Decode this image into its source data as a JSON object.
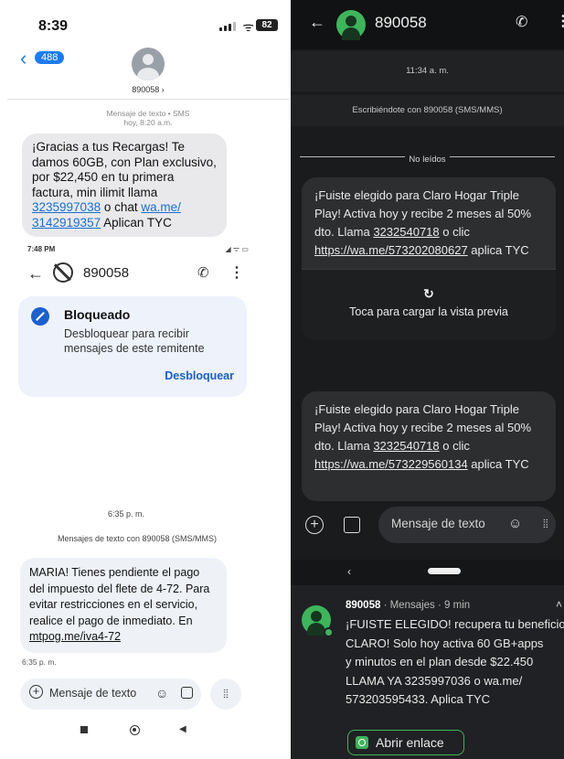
{
  "ios": {
    "status_time": "8:39",
    "battery": "82",
    "back_badge": "488",
    "contact": "890058 ›",
    "meta_line1": "Mensaje de texto • SMS",
    "meta_line2": "hoy, 8:20 a.m.",
    "message": {
      "text1": "¡Gracias a tus Recargas! Te damos 60GB, con Plan exclusivo, por $22,450 en tu primera factura, min ilimit llama ",
      "link1": "3235997038",
      "text2": " o chat ",
      "link2": "wa.me/ 3142919357",
      "text3": " Aplican TYC"
    }
  },
  "android_light": {
    "status_time": "7:48 PM",
    "status_icons": "◢ ᯤ ▭",
    "number": "890058",
    "blocked": {
      "title": "Bloqueado",
      "desc": "Desbloquear para recibir mensajes de este remitente",
      "action": "Desbloquear"
    },
    "time_header": "6:35 p. m.",
    "conversation_header": "Mensajes de texto con 890058 (SMS/MMS)",
    "message": {
      "text": "MARIA! Tienes pendiente el pago del impuesto del flete de 4-72. Para evitar restricciones en el servicio, realice el pago de inmediato. En ",
      "link": "mtpog.me/iva4-72"
    },
    "message_time": "6:35 p. m.",
    "compose_placeholder": "Mensaje de texto"
  },
  "android_dark": {
    "number": "890058",
    "time_header": "11:34 a. m.",
    "conversation_header": "Escribiéndote con 890058 (SMS/MMS)",
    "unread_label": "No leídos",
    "message1": {
      "text1": "¡Fuiste elegido para Claro Hogar Triple Play! Activa hoy y recibe 2 meses al 50% dto. Llama ",
      "phone": "3232540718",
      "text2": " o clic ",
      "link": "https://wa.me/573202080627",
      "text3": " aplica TYC"
    },
    "preview_label": "Toca para cargar la vista previa",
    "message2": {
      "text1": "¡Fuiste elegido para Claro Hogar Triple Play! Activa hoy y recibe 2 meses al 50% dto. Llama ",
      "phone": "3232540718",
      "text2": " o clic ",
      "link": "https://wa.me/573229560134",
      "text3": " aplica TYC"
    },
    "compose_placeholder": "Mensaje de texto"
  },
  "notification": {
    "sender": "890058",
    "subtitle": " · Mensajes · 9 min",
    "lines": [
      "¡FUISTE ELEGIDO! recupera tu beneficio",
      "CLARO! Solo hoy activa 60 GB+apps",
      "y minutos en el plan desde $22.450",
      "LLAMA YA 3235997036 o wa.me/",
      "573203595433. Aplica TYC"
    ],
    "action": "Abrir enlace"
  }
}
